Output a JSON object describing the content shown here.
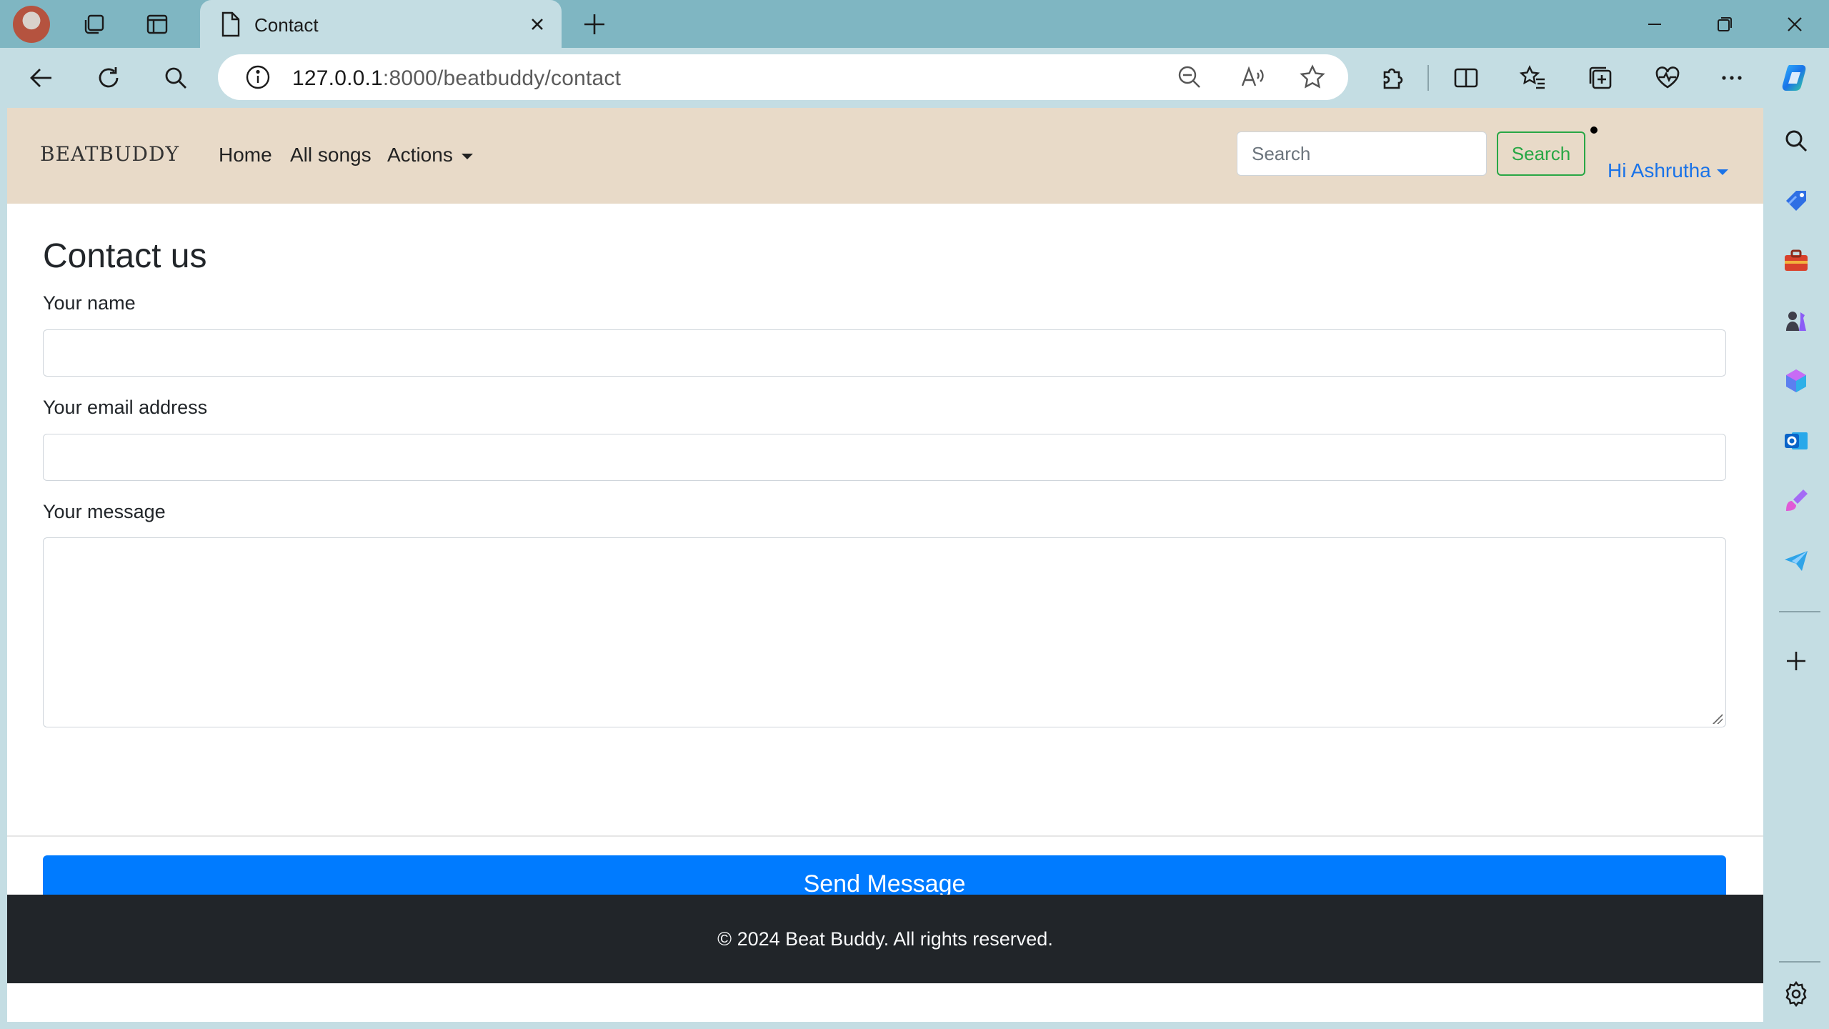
{
  "browser": {
    "tab_title": "Contact",
    "url_host": "127.0.0.1",
    "url_rest": ":8000/beatbuddy/contact"
  },
  "navbar": {
    "brand": "BEATBUDDY",
    "links": [
      "Home",
      "All songs",
      "Actions"
    ],
    "search_placeholder": "Search",
    "search_button": "Search",
    "user_menu": "Hi Ashrutha"
  },
  "form": {
    "title": "Contact us",
    "name_label": "Your name",
    "email_label": "Your email address",
    "message_label": "Your message",
    "submit_label": "Send Message"
  },
  "footer": {
    "text": "© 2024 Beat Buddy. All rights reserved."
  },
  "colors": {
    "tabbar": "#7fb6c2",
    "chrome": "#c4dde3",
    "navbar": "#e8dac8",
    "primary": "#007bff",
    "success": "#28a745",
    "footer": "#212529"
  }
}
